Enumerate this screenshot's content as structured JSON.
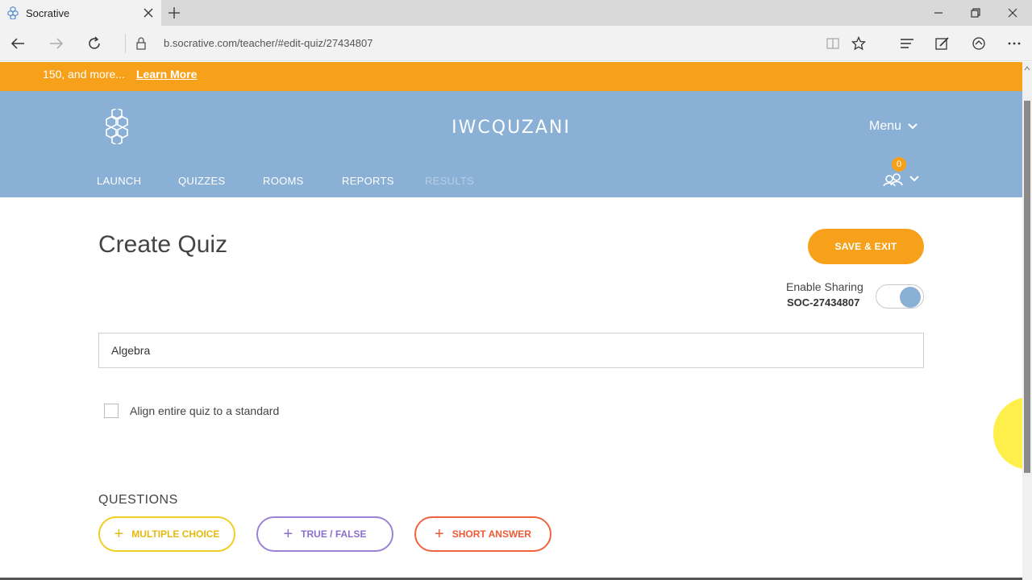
{
  "browser": {
    "tab_title": "Socrative",
    "url": "b.socrative.com/teacher/#edit-quiz/27434807"
  },
  "banner": {
    "text": "150, and more...",
    "link": "Learn More"
  },
  "header": {
    "room_name": "IWCQUZANI",
    "menu_label": "Menu",
    "nav": [
      "LAUNCH",
      "QUIZZES",
      "ROOMS",
      "REPORTS",
      "RESULTS"
    ],
    "badge_count": "0"
  },
  "main": {
    "title": "Create Quiz",
    "save_label": "SAVE & EXIT",
    "sharing_label": "Enable Sharing",
    "sharing_code": "SOC-27434807",
    "sharing_enabled": true,
    "quiz_name_value": "Algebra",
    "align_label": "Align entire quiz to a standard",
    "align_checked": false
  },
  "questions": {
    "title": "QUESTIONS",
    "buttons": [
      "MULTIPLE CHOICE",
      "TRUE / FALSE",
      "SHORT ANSWER"
    ]
  },
  "colors": {
    "orange": "#f7a11a",
    "header_blue": "#8ab0d6",
    "mc_yellow": "#f2cd24",
    "tf_purple": "#9b82d6",
    "sa_red": "#f0623f"
  }
}
